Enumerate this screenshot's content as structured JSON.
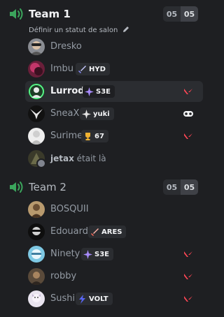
{
  "channels": [
    {
      "name": "Team 1",
      "status": "Définir un statut de salon",
      "count_left": "05",
      "count_right": "05",
      "users": [
        {
          "name": "Dresko",
          "avatar": "dresko",
          "tag": null
        },
        {
          "name": "Imbu",
          "avatar": "imbu",
          "tag": {
            "icon": "sword-icon",
            "text": "HYD"
          }
        },
        {
          "name": "Lurrod",
          "avatar": "lurrod",
          "tag": {
            "icon": "sparkle-icon",
            "text": "S3E"
          },
          "activity": "valorant-icon"
        },
        {
          "name": "SneaX",
          "avatar": "sneax",
          "tag": {
            "icon": "sparkle-icon",
            "text": "yuki"
          },
          "activity": "mask-icon"
        },
        {
          "name": "Surime",
          "avatar": "surime",
          "tag": {
            "icon": "trophy-icon",
            "text": "67"
          },
          "activity": "valorant-icon"
        }
      ],
      "was_here": {
        "name": "jetax",
        "text": "était là"
      }
    },
    {
      "name": "Team 2",
      "count_left": "05",
      "count_right": "05",
      "users": [
        {
          "name": "BOSQUII",
          "avatar": "bosquii",
          "tag": null
        },
        {
          "name": "Edouard",
          "avatar": "edouard",
          "tag": {
            "icon": "sword-icon",
            "text": "ARES"
          }
        },
        {
          "name": "Ninety",
          "avatar": "ninety",
          "tag": {
            "icon": "sparkle-icon",
            "text": "S3E"
          },
          "activity": "valorant-icon"
        },
        {
          "name": "robby",
          "avatar": "robby",
          "tag": null,
          "activity": "valorant-icon"
        },
        {
          "name": "Sushi",
          "avatar": "sushi",
          "tag": {
            "icon": "bolt-icon",
            "text": "VOLT"
          },
          "activity": "valorant-icon"
        }
      ]
    }
  ],
  "colors": {
    "background": "#1e1f22",
    "active_row": "#2b2d31",
    "voice_icon": "#3ba55c",
    "valorant": "#ff4655",
    "sparkle": "#a78bfa",
    "trophy": "#f0b232",
    "bolt": "#5865f2"
  }
}
